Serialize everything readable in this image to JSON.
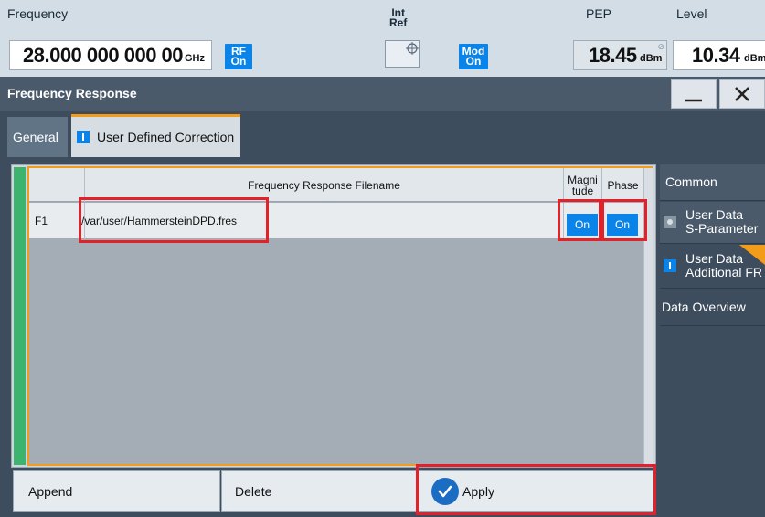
{
  "status_bar": {
    "frequency_label": "Frequency",
    "frequency_value": "28.000 000 000 00",
    "frequency_unit": "GHz",
    "rf_line1": "RF",
    "rf_line2": "On",
    "int_line1": "Int",
    "int_line2": "Ref",
    "mod_line1": "Mod",
    "mod_line2": "On",
    "pep_label": "PEP",
    "pep_value": "18.45",
    "pep_unit": "dBm",
    "level_label": "Level",
    "level_value": "10.34",
    "level_unit": "dBm"
  },
  "dialog": {
    "title": "Frequency Response",
    "minimize_icon": "minimize-icon",
    "close_icon": "close-icon"
  },
  "tabs": [
    {
      "label": "General",
      "active": false
    },
    {
      "label": "User Defined Correction",
      "active": true
    }
  ],
  "table": {
    "headers": {
      "filename": "Frequency Response Filename",
      "magnitude_line1": "Magni",
      "magnitude_line2": "tude",
      "phase": "Phase"
    },
    "rows": [
      {
        "id": "F1",
        "filename": "/var/user/HammersteinDPD.fres",
        "magnitude": "On",
        "phase": "On"
      }
    ]
  },
  "buttons": {
    "append": "Append",
    "delete": "Delete",
    "apply": "Apply"
  },
  "right_nav": {
    "items": [
      {
        "line1": "Common",
        "line2": ""
      },
      {
        "line1": "User Data",
        "line2": "S-Parameter"
      },
      {
        "line1": "User Data",
        "line2": "Additional FR"
      },
      {
        "line1": "Data Overview",
        "line2": ""
      }
    ]
  },
  "colors": {
    "accent_blue": "#0a84e8",
    "highlight_red": "#e3212b",
    "active_orange": "#f39c1a",
    "panel_dark": "#3d4d5e"
  }
}
